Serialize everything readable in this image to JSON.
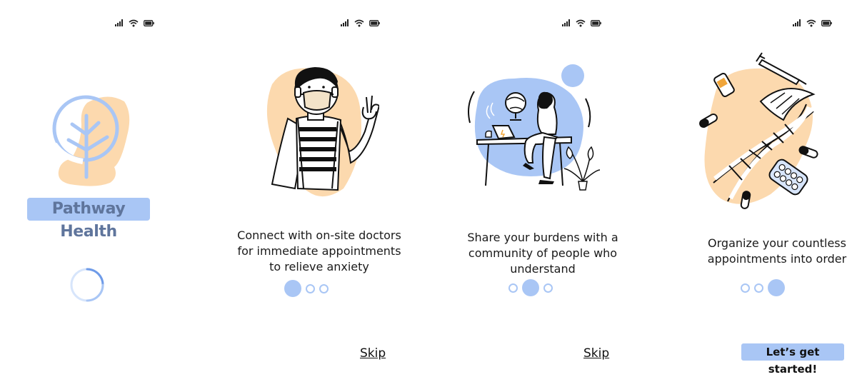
{
  "colors": {
    "accent_blue": "#a9c6f5",
    "accent_peach": "#fcd9ae",
    "brand_text": "#5f759c"
  },
  "status_bar": {
    "icons": [
      "signal-icon",
      "wifi-icon",
      "battery-icon"
    ]
  },
  "splash": {
    "brand_name": "Pathway Health",
    "illustration": "tree-logo-icon",
    "loading": "spinner-icon"
  },
  "onboarding": [
    {
      "illustration": "masked-doctor-illustration",
      "caption_lines": [
        "Connect with on-site doctors",
        "for immediate appointments",
        "to relieve anxiety"
      ],
      "active_dot": 0,
      "skip_label": "Skip"
    },
    {
      "illustration": "person-at-desk-illustration",
      "caption_lines": [
        "Share your burdens with a",
        "community of people who",
        "understand"
      ],
      "active_dot": 1,
      "skip_label": "Skip"
    },
    {
      "illustration": "medical-dna-illustration",
      "caption_lines": [
        "Organize your countless",
        "appointments into order"
      ],
      "active_dot": 2,
      "cta_label": "Let’s get started!"
    }
  ]
}
